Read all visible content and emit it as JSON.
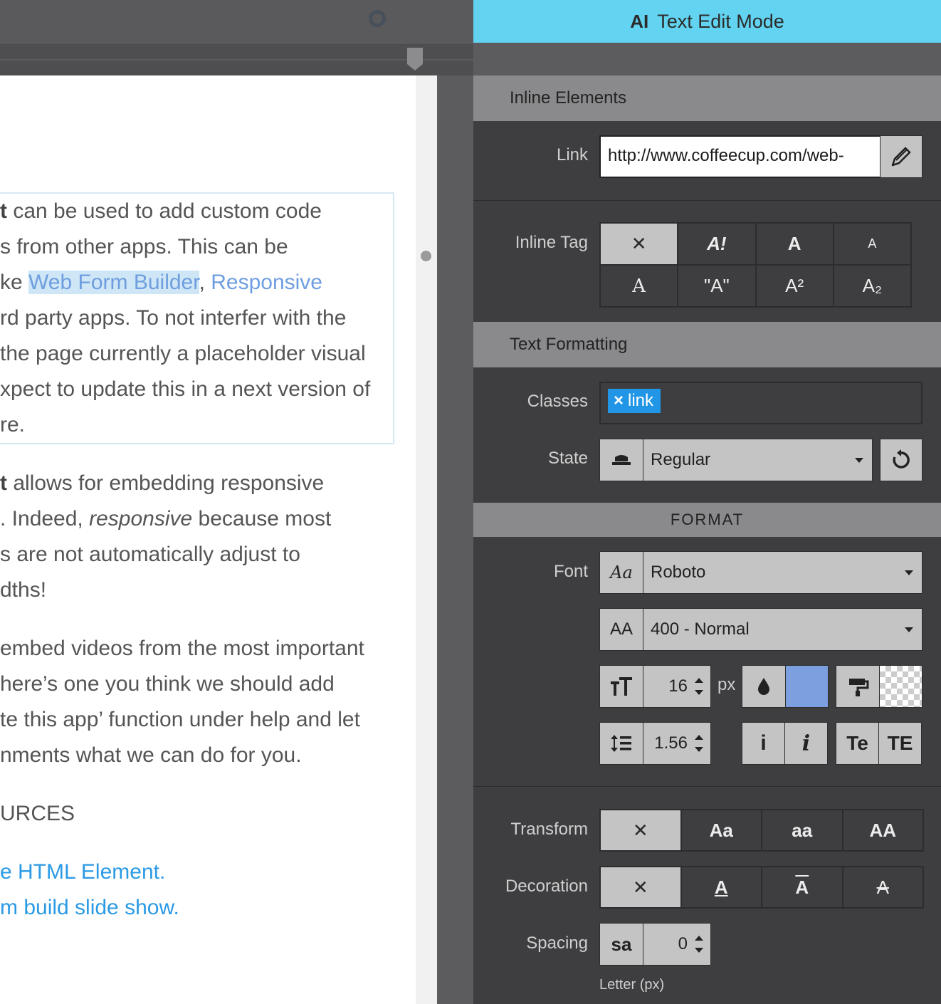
{
  "panel": {
    "mode_icon": "AI",
    "mode_title": "Text Edit Mode",
    "inline_elements": {
      "heading": "Inline Elements",
      "link_label": "Link",
      "link_value": "http://www.coffeecup.com/web-"
    },
    "inline_tag": {
      "label": "Inline Tag",
      "buttons": [
        "✕",
        "A!",
        "A",
        "A",
        "A",
        "\"A\"",
        "A²",
        "A₂"
      ]
    },
    "text_formatting": {
      "heading": "Text Formatting",
      "classes_label": "Classes",
      "class_tag": "link",
      "class_tag_remove": "×",
      "state_label": "State",
      "state_value": "Regular"
    },
    "format": {
      "heading": "FORMAT",
      "font_label": "Font",
      "font_icon": "Aa",
      "font_value": "Roboto",
      "weight_icon": "AA",
      "weight_value": "400 - Normal",
      "size_value": "16",
      "size_unit": "px",
      "text_color": "#7b9fdf",
      "line_height_value": "1.56",
      "italic_off": "i",
      "italic_on": "i",
      "case_1": "Te",
      "case_2": "TE"
    },
    "transform": {
      "label": "Transform",
      "buttons": [
        "✕",
        "Aa",
        "aa",
        "AA"
      ]
    },
    "decoration": {
      "label": "Decoration",
      "buttons": [
        "✕",
        "A",
        "A",
        "A"
      ]
    },
    "spacing": {
      "label": "Spacing",
      "icon": "sa",
      "value": "0",
      "caption": "Letter (px)"
    }
  },
  "document": {
    "p1": {
      "l1_bold": "t",
      "l1_rest": " can be used to add custom code",
      "l2": "s from other apps. This can be",
      "l3_pre": "ke ",
      "l3_link1": "Web Form Builder",
      "l3_comma": ", ",
      "l3_link2": "Responsive",
      "l4": "rd party apps. To not interfer with the",
      "l5": " the page currently a placeholder visual",
      "l6": "xpect to update this in a next version of",
      "l7": "re."
    },
    "p2": {
      "l1_bold": "t",
      "l1_rest": " allows for embedding responsive",
      "l2_pre": ". Indeed, ",
      "l2_it": "responsive",
      "l2_post": " because most",
      "l3": "s are not automatically adjust to",
      "l4": "dths!"
    },
    "p3": {
      "l1": "embed videos from the most important",
      "l2": "here’s one you think we should add",
      "l3": "te this app’ function under help and let",
      "l4": "nments what we can do for you."
    },
    "heading": "URCES",
    "link1": "e HTML Element.",
    "link2": "m build slide show."
  }
}
